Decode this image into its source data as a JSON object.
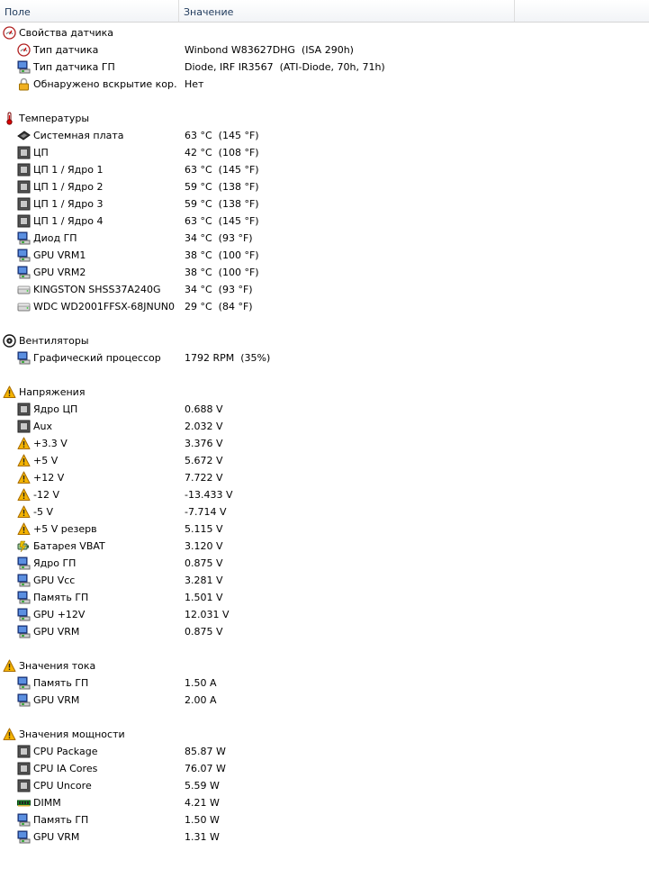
{
  "header": {
    "col_field": "Поле",
    "col_value": "Значение"
  },
  "rows": [
    {
      "t": "cat",
      "icon": "sensor-gauge-icon",
      "f": "Свойства датчика",
      "v": ""
    },
    {
      "t": "item",
      "icon": "sensor-gauge-icon",
      "f": "Тип датчика",
      "v": "Winbond W83627DHG  (ISA 290h)"
    },
    {
      "t": "item",
      "icon": "monitor-icon",
      "f": "Тип датчика ГП",
      "v": "Diode, IRF IR3567  (ATI-Diode, 70h, 71h)"
    },
    {
      "t": "item",
      "icon": "padlock-icon",
      "f": "Обнаружено вскрытие кор…",
      "v": "Нет"
    },
    {
      "t": "blank"
    },
    {
      "t": "cat",
      "icon": "thermometer-icon",
      "f": "Температуры",
      "v": ""
    },
    {
      "t": "item",
      "icon": "motherboard-icon",
      "f": "Системная плата",
      "v": "63 °C  (145 °F)"
    },
    {
      "t": "item",
      "icon": "cpu-chip-icon",
      "f": "ЦП",
      "v": "42 °C  (108 °F)"
    },
    {
      "t": "item",
      "icon": "cpu-chip-icon",
      "f": "ЦП 1 / Ядро 1",
      "v": "63 °C  (145 °F)"
    },
    {
      "t": "item",
      "icon": "cpu-chip-icon",
      "f": "ЦП 1 / Ядро 2",
      "v": "59 °C  (138 °F)"
    },
    {
      "t": "item",
      "icon": "cpu-chip-icon",
      "f": "ЦП 1 / Ядро 3",
      "v": "59 °C  (138 °F)"
    },
    {
      "t": "item",
      "icon": "cpu-chip-icon",
      "f": "ЦП 1 / Ядро 4",
      "v": "63 °C  (145 °F)"
    },
    {
      "t": "item",
      "icon": "monitor-icon",
      "f": "Диод ГП",
      "v": "34 °C  (93 °F)"
    },
    {
      "t": "item",
      "icon": "monitor-icon",
      "f": "GPU VRM1",
      "v": "38 °C  (100 °F)"
    },
    {
      "t": "item",
      "icon": "monitor-icon",
      "f": "GPU VRM2",
      "v": "38 °C  (100 °F)"
    },
    {
      "t": "item",
      "icon": "hard-drive-icon",
      "f": "KINGSTON SHSS37A240G",
      "v": "34 °C  (93 °F)"
    },
    {
      "t": "item",
      "icon": "hard-drive-icon",
      "f": "WDC WD2001FFSX-68JNUN0",
      "v": "29 °C  (84 °F)"
    },
    {
      "t": "blank"
    },
    {
      "t": "cat",
      "icon": "fan-icon",
      "f": "Вентиляторы",
      "v": ""
    },
    {
      "t": "item",
      "icon": "monitor-icon",
      "f": "Графический процессор",
      "v": "1792 RPM  (35%)"
    },
    {
      "t": "blank"
    },
    {
      "t": "cat",
      "icon": "warning-icon",
      "f": "Напряжения",
      "v": ""
    },
    {
      "t": "item",
      "icon": "cpu-chip-icon",
      "f": "Ядро ЦП",
      "v": "0.688 V"
    },
    {
      "t": "item",
      "icon": "cpu-chip-icon",
      "f": "Aux",
      "v": "2.032 V"
    },
    {
      "t": "item",
      "icon": "warning-icon",
      "f": "+3.3 V",
      "v": "3.376 V"
    },
    {
      "t": "item",
      "icon": "warning-icon",
      "f": "+5 V",
      "v": "5.672 V"
    },
    {
      "t": "item",
      "icon": "warning-icon",
      "f": "+12 V",
      "v": "7.722 V"
    },
    {
      "t": "item",
      "icon": "warning-icon",
      "f": "-12 V",
      "v": "-13.433 V"
    },
    {
      "t": "item",
      "icon": "warning-icon",
      "f": "-5 V",
      "v": "-7.714 V"
    },
    {
      "t": "item",
      "icon": "warning-icon",
      "f": "+5 V резерв",
      "v": "5.115 V"
    },
    {
      "t": "item",
      "icon": "battery-icon",
      "f": "Батарея VBAT",
      "v": "3.120 V"
    },
    {
      "t": "item",
      "icon": "monitor-icon",
      "f": "Ядро ГП",
      "v": "0.875 V"
    },
    {
      "t": "item",
      "icon": "monitor-icon",
      "f": "GPU Vcc",
      "v": "3.281 V"
    },
    {
      "t": "item",
      "icon": "monitor-icon",
      "f": "Память ГП",
      "v": "1.501 V"
    },
    {
      "t": "item",
      "icon": "monitor-icon",
      "f": "GPU +12V",
      "v": "12.031 V"
    },
    {
      "t": "item",
      "icon": "monitor-icon",
      "f": "GPU VRM",
      "v": "0.875 V"
    },
    {
      "t": "blank"
    },
    {
      "t": "cat",
      "icon": "warning-icon",
      "f": "Значения тока",
      "v": ""
    },
    {
      "t": "item",
      "icon": "monitor-icon",
      "f": "Память ГП",
      "v": "1.50 A"
    },
    {
      "t": "item",
      "icon": "monitor-icon",
      "f": "GPU VRM",
      "v": "2.00 A"
    },
    {
      "t": "blank"
    },
    {
      "t": "cat",
      "icon": "warning-icon",
      "f": "Значения мощности",
      "v": ""
    },
    {
      "t": "item",
      "icon": "cpu-chip-icon",
      "f": "CPU Package",
      "v": "85.87 W"
    },
    {
      "t": "item",
      "icon": "cpu-chip-icon",
      "f": "CPU IA Cores",
      "v": "76.07 W"
    },
    {
      "t": "item",
      "icon": "cpu-chip-icon",
      "f": "CPU Uncore",
      "v": "5.59 W"
    },
    {
      "t": "item",
      "icon": "memory-module-icon",
      "f": "DIMM",
      "v": "4.21 W"
    },
    {
      "t": "item",
      "icon": "monitor-icon",
      "f": "Память ГП",
      "v": "1.50 W"
    },
    {
      "t": "item",
      "icon": "monitor-icon",
      "f": "GPU VRM",
      "v": "1.31 W"
    }
  ]
}
